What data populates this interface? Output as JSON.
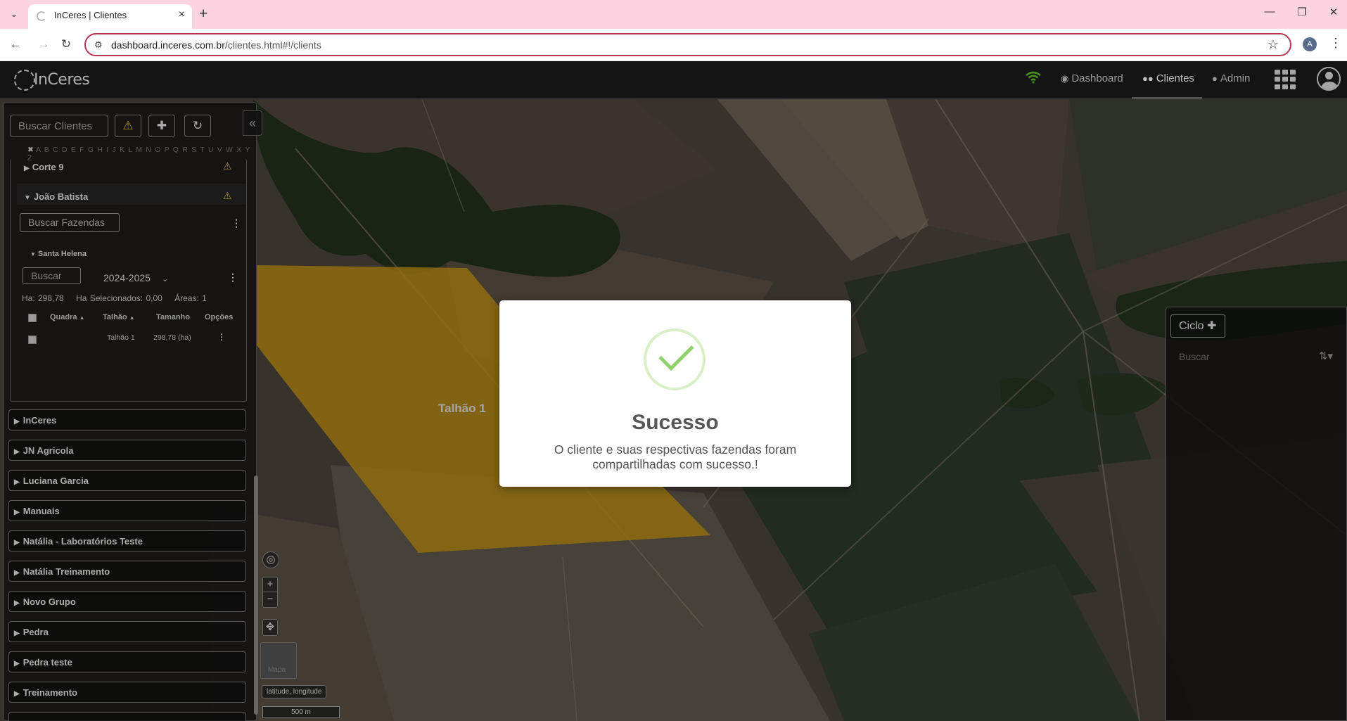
{
  "browser": {
    "tab_title": "InCeres | Clientes",
    "url_host": "dashboard.inceres.com.br",
    "url_path": "/clientes.html#!/clients",
    "profile_initial": "A"
  },
  "header": {
    "logo_text": "InCeres",
    "nav": [
      {
        "label": "Dashboard",
        "icon": "dashboard-icon"
      },
      {
        "label": "Clientes",
        "icon": "users-icon"
      },
      {
        "label": "Admin",
        "icon": "admin-icon"
      }
    ],
    "wifi_color": "#5bbf2e"
  },
  "sidebar": {
    "search_placeholder": "Buscar Clientes",
    "alphabet": "A B C D E F G H I J K L M N O P Q R S T U V W X Y Z",
    "clients_top": [
      {
        "label": "Corte 9"
      },
      {
        "label": "João Batista"
      }
    ],
    "farms_search_placeholder": "Buscar Fazendas",
    "farm": {
      "name": "Santa Helena",
      "search_placeholder": "Buscar",
      "season": "2024-2025",
      "stats_ha": "Ha: 298,78",
      "stats_selected": "Ha Selecionados: 0,00",
      "stats_areas": "Áreas: 1",
      "columns": [
        "Quadra",
        "Talhão",
        "Tamanho",
        "Opções"
      ],
      "rows": [
        {
          "quadra": "",
          "talhao": "Talhão 1",
          "tamanho": "298,78 (ha)"
        }
      ]
    },
    "groups": [
      "InCeres",
      "JN Agricola",
      "Luciana Garcia",
      "Manuais",
      "Natália - Laboratórios Teste",
      "Natália Treinamento",
      "Novo Grupo",
      "Pedra",
      "Pedra teste",
      "Treinamento"
    ]
  },
  "map": {
    "field_label": "Talhão 1",
    "field_color": "#c39214",
    "mapa_label": "Mapa",
    "latlng_label": "latitude, longitude",
    "scale_label": "500 m"
  },
  "right_panel": {
    "ciclo_label": "Ciclo",
    "search_placeholder": "Buscar"
  },
  "modal": {
    "title": "Sucesso",
    "message": "O cliente e suas respectivas fazendas foram compartilhadas com sucesso.!"
  }
}
